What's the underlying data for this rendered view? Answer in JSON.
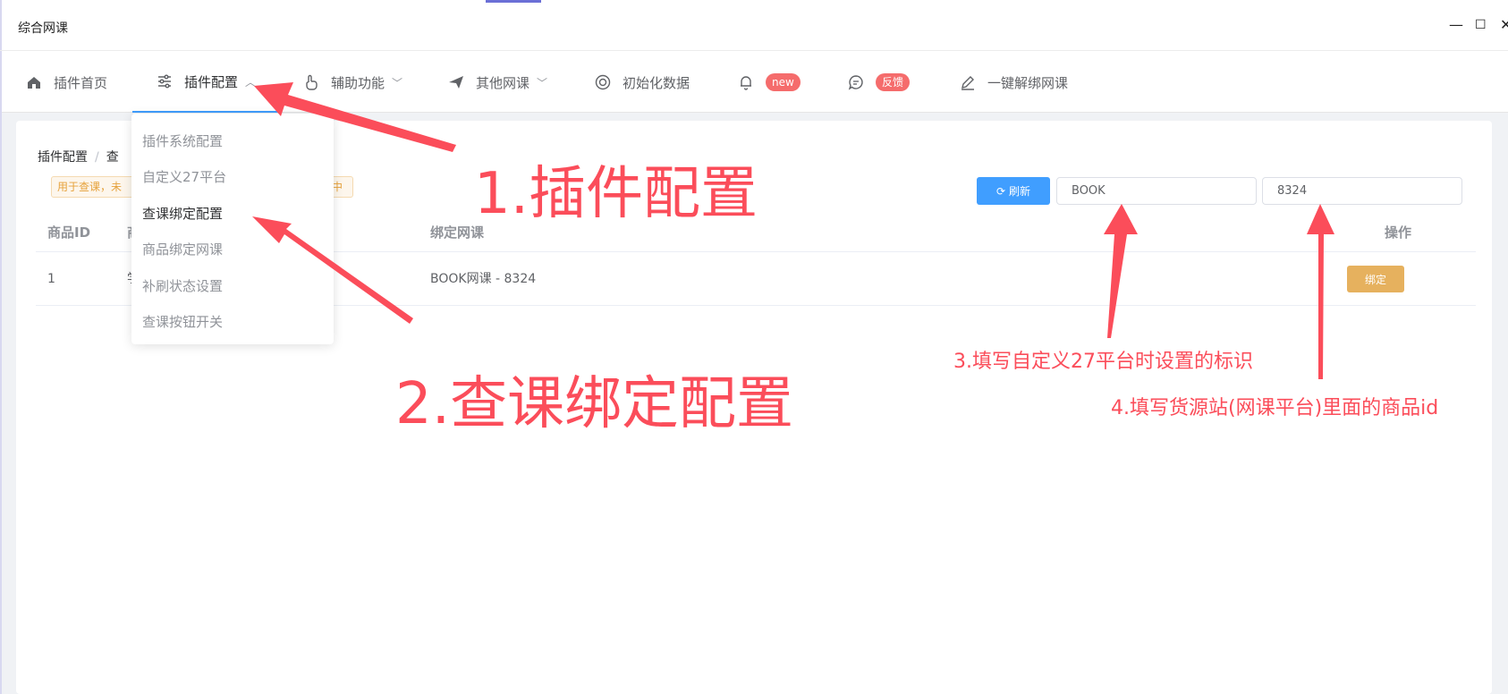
{
  "window": {
    "title": "综合网课",
    "minimize": "—",
    "maximize": "☐",
    "close": "✕"
  },
  "nav": [
    {
      "label": "插件首页",
      "icon": "home-icon"
    },
    {
      "label": "插件配置",
      "icon": "sliders-icon",
      "active": true
    },
    {
      "label": "辅助功能",
      "icon": "hand-pointer-icon"
    },
    {
      "label": "其他网课",
      "icon": "paper-plane-icon"
    },
    {
      "label": "初始化数据",
      "icon": "lifebuoy-icon"
    },
    {
      "label": "new",
      "icon": "bell-icon"
    },
    {
      "label": "反馈",
      "icon": "chat-icon"
    },
    {
      "label": "一键解绑网课",
      "icon": "pen-icon"
    }
  ],
  "dropdown": [
    "插件系统配置",
    "自定义27平台",
    "查课绑定配置",
    "商品绑定网课",
    "补刷状态设置",
    "查课按钮开关"
  ],
  "breadcrumb": {
    "root": "插件配置",
    "current": "查"
  },
  "tag": "用于查课，未",
  "tag_tail": "中",
  "toolbar": {
    "refresh_label": "刷新",
    "platform_value": "BOOK",
    "goods_id_value": "8324"
  },
  "table": {
    "headers": {
      "id": "商品ID",
      "name": "商",
      "bind": "绑定网课",
      "action": "操作"
    },
    "rows": [
      {
        "id": "1",
        "name": "学",
        "bind": "BOOK网课 - 8324",
        "action": "绑定"
      }
    ]
  },
  "annotations": {
    "step1": "1.插件配置",
    "step2": "2.查课绑定配置",
    "step3": "3.填写自定义27平台时设置的标识",
    "step4": "4.填写货源站(网课平台)里面的商品id"
  },
  "colors": {
    "accent": "#409eff",
    "annotation": "#fb4d5a",
    "warning": "#e6b15e",
    "badge": "#f56c6c"
  }
}
